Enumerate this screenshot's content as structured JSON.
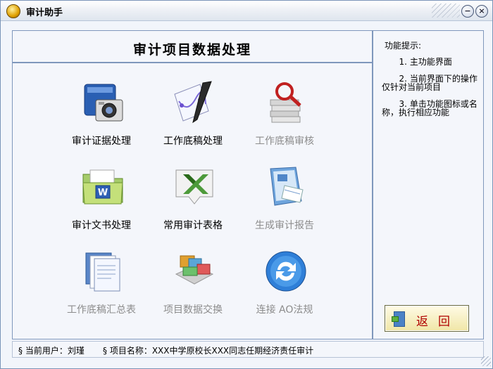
{
  "window": {
    "title": "审计助手"
  },
  "header": {
    "title": "审计项目数据处理"
  },
  "tools": [
    {
      "name": "audit-evidence",
      "label": "审计证据处理",
      "icon": "camera-book-icon",
      "enabled": true
    },
    {
      "name": "working-paper",
      "label": "工作底稿处理",
      "icon": "pen-chart-icon",
      "enabled": true
    },
    {
      "name": "working-paper-review",
      "label": "工作底稿审核",
      "icon": "magnifier-docs-icon",
      "enabled": false
    },
    {
      "name": "audit-document",
      "label": "审计文书处理",
      "icon": "word-folder-icon",
      "enabled": true
    },
    {
      "name": "audit-table",
      "label": "常用审计表格",
      "icon": "excel-icon",
      "enabled": true
    },
    {
      "name": "audit-report",
      "label": "生成审计报告",
      "icon": "report-icon",
      "enabled": false
    },
    {
      "name": "working-paper-summary",
      "label": "工作底稿汇总表",
      "icon": "documents-icon",
      "enabled": false
    },
    {
      "name": "project-exchange",
      "label": "项目数据交换",
      "icon": "data-exchange-icon",
      "enabled": false
    },
    {
      "name": "ao-regulations",
      "label": "连接 AO法规",
      "icon": "refresh-icon",
      "enabled": false
    }
  ],
  "sidebar": {
    "tips_title": "功能提示:",
    "tips": [
      {
        "num": "1.",
        "text": "主功能界面"
      },
      {
        "num": "2.",
        "text": "当前界面下的操作仅针对当前项目"
      },
      {
        "num": "3.",
        "text": "单击功能图标或名称，执行相应功能"
      }
    ],
    "back_label": "返回"
  },
  "status": {
    "user": "§ 当前用户：刘瑾",
    "project": "§ 项目名称：XXX中学原校长XXX同志任期经济责任审计"
  },
  "colors": {
    "accent": "#7f97bc",
    "back_text": "#b00000",
    "disabled_text": "#8c8c8c"
  }
}
